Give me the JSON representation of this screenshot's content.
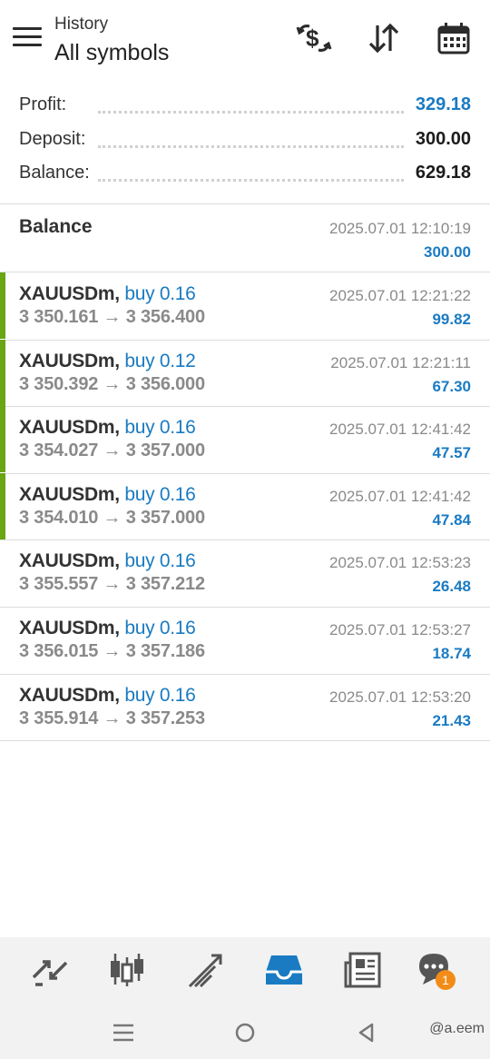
{
  "header": {
    "subtitle": "History",
    "title": "All symbols",
    "icons": [
      "menu-icon",
      "currency-exchange-icon",
      "sort-icon",
      "calendar-icon"
    ]
  },
  "summary": {
    "profit_label": "Profit:",
    "profit_value": "329.18",
    "deposit_label": "Deposit:",
    "deposit_value": "300.00",
    "balance_label": "Balance:",
    "balance_value": "629.18"
  },
  "balance_entry": {
    "label": "Balance",
    "time": "2025.07.01 12:10:19",
    "amount": "300.00"
  },
  "deals": [
    {
      "symbol": "XAUUSDm,",
      "type": "buy 0.16",
      "open": "3 350.161",
      "arrow": "→",
      "close": "3 356.400",
      "time": "2025.07.01 12:21:22",
      "profit": "99.82",
      "highlight": true
    },
    {
      "symbol": "XAUUSDm,",
      "type": "buy 0.12",
      "open": "3 350.392",
      "arrow": "→",
      "close": "3 356.000",
      "time": "2025.07.01 12:21:11",
      "profit": "67.30",
      "highlight": true
    },
    {
      "symbol": "XAUUSDm,",
      "type": "buy 0.16",
      "open": "3 354.027",
      "arrow": "→",
      "close": "3 357.000",
      "time": "2025.07.01 12:41:42",
      "profit": "47.57",
      "highlight": true
    },
    {
      "symbol": "XAUUSDm,",
      "type": "buy 0.16",
      "open": "3 354.010",
      "arrow": "→",
      "close": "3 357.000",
      "time": "2025.07.01 12:41:42",
      "profit": "47.84",
      "highlight": true
    },
    {
      "symbol": "XAUUSDm,",
      "type": "buy 0.16",
      "open": "3 355.557",
      "arrow": "→",
      "close": "3 357.212",
      "time": "2025.07.01 12:53:23",
      "profit": "26.48",
      "highlight": false
    },
    {
      "symbol": "XAUUSDm,",
      "type": "buy 0.16",
      "open": "3 356.015",
      "arrow": "→",
      "close": "3 357.186",
      "time": "2025.07.01 12:53:27",
      "profit": "18.74",
      "highlight": false
    },
    {
      "symbol": "XAUUSDm,",
      "type": "buy 0.16",
      "open": "3 355.914",
      "arrow": "→",
      "close": "3 357.253",
      "time": "2025.07.01 12:53:20",
      "profit": "21.43",
      "highlight": false
    }
  ],
  "tabbar": {
    "icons": [
      "quotes-icon",
      "chart-icon",
      "trade-icon",
      "history-icon",
      "news-icon",
      "chat-icon"
    ],
    "active": "history-icon",
    "chat_badge": "1"
  },
  "sysnav": {
    "icons": [
      "recent-apps-icon",
      "home-icon",
      "back-icon"
    ],
    "watermark": "@a.eem"
  },
  "colors": {
    "accent_blue": "#1a7bc2",
    "profit_bar_green": "#6aa512",
    "badge_orange": "#f28c16"
  }
}
